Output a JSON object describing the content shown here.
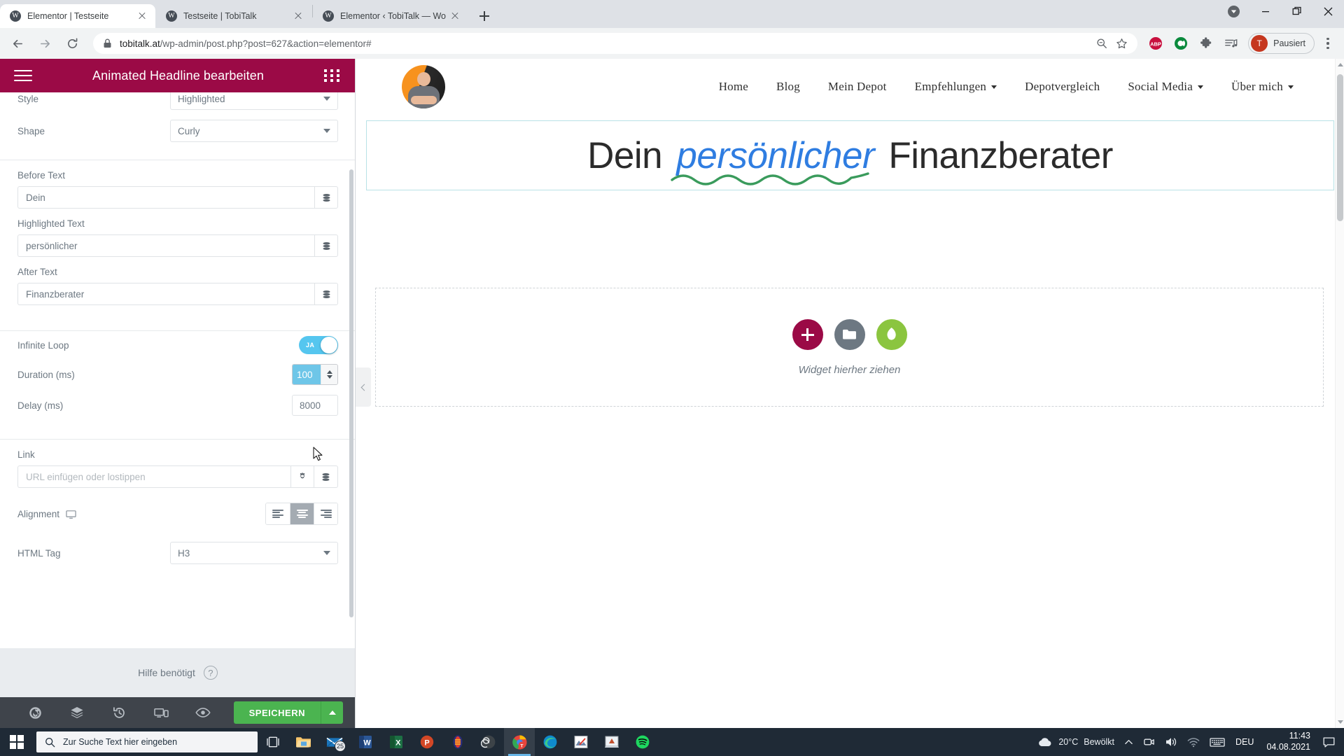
{
  "browser": {
    "tabs": [
      {
        "title": "Elementor | Testseite",
        "active": true,
        "favicon": "W"
      },
      {
        "title": "Testseite | TobiTalk",
        "active": false,
        "favicon": "W"
      },
      {
        "title": "Elementor ‹ TobiTalk — WordPre",
        "active": false,
        "favicon": "W"
      }
    ],
    "newtab_label": "Neuer Tab",
    "url_domain": "tobitalk.at",
    "url_path": "/wp-admin/post.php?post=627&action=elementor#",
    "profile_name": "Pausiert",
    "profile_initial": "T",
    "extensions": [
      "abp-icon",
      "ccleaner-icon",
      "puzzle-extensions-icon",
      "media-list-icon"
    ],
    "nav": {
      "back": "Zurück",
      "forward": "Vorwärts",
      "reload": "Neu laden"
    },
    "window": {
      "minimize": "Minimieren",
      "maximize": "Maximieren",
      "close": "Schließen",
      "download": "Downloads"
    }
  },
  "elementor": {
    "header_title": "Animated Headline bearbeiten",
    "fields": {
      "style_label": "Style",
      "style_value": "Highlighted",
      "shape_label": "Shape",
      "shape_value": "Curly",
      "before_label": "Before Text",
      "before_value": "Dein",
      "highlighted_label": "Highlighted Text",
      "highlighted_value": "persönlicher",
      "after_label": "After Text",
      "after_value": "Finanzberater",
      "infinite_label": "Infinite Loop",
      "infinite_state": "JA",
      "duration_label": "Duration (ms)",
      "duration_value": "100",
      "delay_label": "Delay (ms)",
      "delay_value": "8000",
      "link_label": "Link",
      "link_placeholder": "URL einfügen oder lostippen",
      "alignment_label": "Alignment",
      "htmltag_label": "HTML Tag",
      "htmltag_value": "H3"
    },
    "help_text": "Hilfe benötigt",
    "save_label": "SPEICHERN",
    "bottom_icons": [
      "settings-gear-icon",
      "layers-navigator-icon",
      "history-revisions-icon",
      "responsive-mode-icon",
      "preview-eye-icon"
    ],
    "colors": {
      "header": "#9b0a46",
      "save": "#4bb450",
      "toggle_on": "#55c6ef"
    }
  },
  "preview": {
    "nav_items": [
      {
        "label": "Home",
        "dropdown": false
      },
      {
        "label": "Blog",
        "dropdown": false
      },
      {
        "label": "Mein Depot",
        "dropdown": false
      },
      {
        "label": "Empfehlungen",
        "dropdown": true
      },
      {
        "label": "Depotvergleich",
        "dropdown": false
      },
      {
        "label": "Social Media",
        "dropdown": true
      },
      {
        "label": "Über mich",
        "dropdown": true
      }
    ],
    "headline": {
      "before": "Dein",
      "highlighted": "persönlicher",
      "after": "Finanzberater",
      "highlight_color": "#2f7de1",
      "shape_color": "#3a9b5c"
    },
    "dropzone_text": "Widget hierher ziehen",
    "dropzone_buttons": [
      "add-element-icon",
      "template-folder-icon",
      "leaf-icon"
    ]
  },
  "taskbar": {
    "search_placeholder": "Zur Suche Text hier eingeben",
    "apps": [
      {
        "name": "task-view-icon"
      },
      {
        "name": "file-explorer-icon"
      },
      {
        "name": "mail-icon",
        "badge": "25"
      },
      {
        "name": "word-icon",
        "letter": "W"
      },
      {
        "name": "excel-icon",
        "letter": "X"
      },
      {
        "name": "powerpoint-icon",
        "letter": "P"
      },
      {
        "name": "app-icon"
      },
      {
        "name": "obs-icon"
      },
      {
        "name": "chrome-icon",
        "active": true
      },
      {
        "name": "edge-icon"
      },
      {
        "name": "photo-editor-icon"
      },
      {
        "name": "notes-icon"
      },
      {
        "name": "spotify-icon"
      }
    ],
    "weather_temp": "20°C",
    "weather_desc": "Bewölkt",
    "language": "DEU",
    "time": "11:43",
    "date": "04.08.2021"
  }
}
